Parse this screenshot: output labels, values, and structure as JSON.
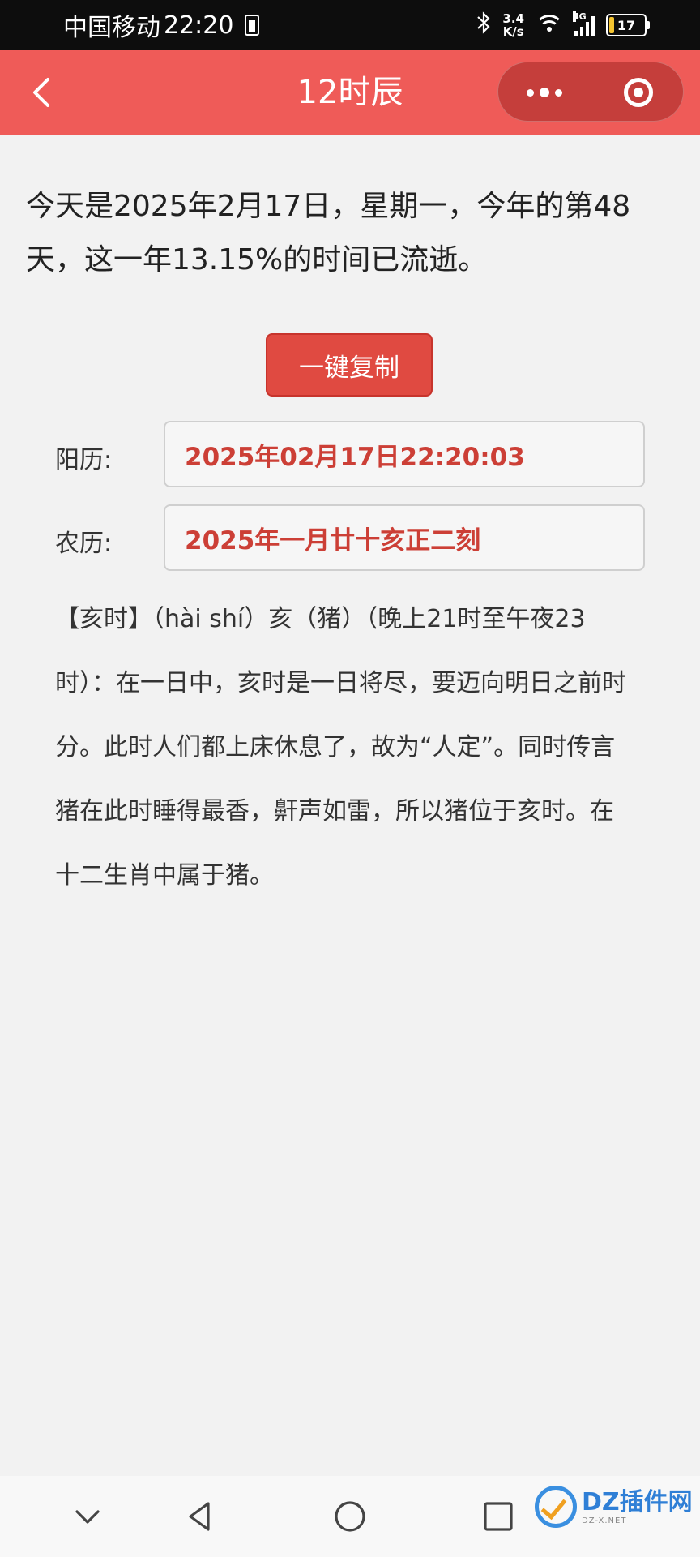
{
  "status_bar": {
    "carrier": "中国移动",
    "time": "22:20",
    "speed_value": "3.4",
    "speed_unit": "K/s",
    "network_type": "4G",
    "battery": "17",
    "battery_level_percent": 17
  },
  "header": {
    "title": "12时辰",
    "back_icon": "chevron-left-icon",
    "more_icon": "more-dots-icon",
    "close_icon": "target-close-icon"
  },
  "intro": "今天是2025年2月17日，星期一，今年的第48天，这一年13.15%的时间已流逝。",
  "copy_button": "一键复制",
  "solar": {
    "label": "阳历:",
    "value": "2025年02月17日22:20:03"
  },
  "lunar": {
    "label": "农历:",
    "value": "2025年一月廿十亥正二刻"
  },
  "description": "【亥时】（hài shí）亥（猪）（晚上21时至午夜23时）：在一日中，亥时是一日将尽，要迈向明日之前时分。此时人们都上床休息了，故为“人定”。同时传言猪在此时睡得最香，鼾声如雷，所以猪位于亥时。在十二生肖中属于猪。",
  "navbar": {
    "icons": [
      "chevron-down-icon",
      "back-triangle-icon",
      "home-circle-icon",
      "recents-square-icon"
    ]
  },
  "watermark": {
    "text": "DZ插件网",
    "sub": "DZ-X.NET"
  },
  "colors": {
    "header_bg": "#ef5b58",
    "accent_red": "#cc3f36",
    "button_bg": "#e04a41",
    "page_bg": "#f2f2f2"
  }
}
